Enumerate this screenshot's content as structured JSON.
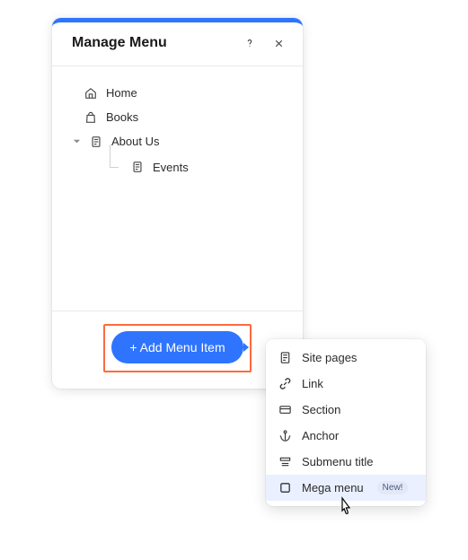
{
  "panel": {
    "title": "Manage Menu",
    "help_tooltip": "?",
    "close_tooltip": "×"
  },
  "menu_items": {
    "0": {
      "label": "Home",
      "icon": "home-icon"
    },
    "1": {
      "label": "Books",
      "icon": "bag-icon"
    },
    "2": {
      "label": "About Us",
      "icon": "page-icon"
    },
    "2_children": {
      "0": {
        "label": "Events",
        "icon": "page-icon"
      }
    }
  },
  "footer": {
    "add_button_label": "+ Add Menu Item"
  },
  "dropdown": {
    "items": {
      "0": {
        "label": "Site pages",
        "icon": "page-icon"
      },
      "1": {
        "label": "Link",
        "icon": "link-icon"
      },
      "2": {
        "label": "Section",
        "icon": "section-icon"
      },
      "3": {
        "label": "Anchor",
        "icon": "anchor-icon"
      },
      "4": {
        "label": "Submenu title",
        "icon": "submenu-icon"
      },
      "5": {
        "label": "Mega menu",
        "icon": "square-icon",
        "badge": "New!"
      }
    }
  }
}
